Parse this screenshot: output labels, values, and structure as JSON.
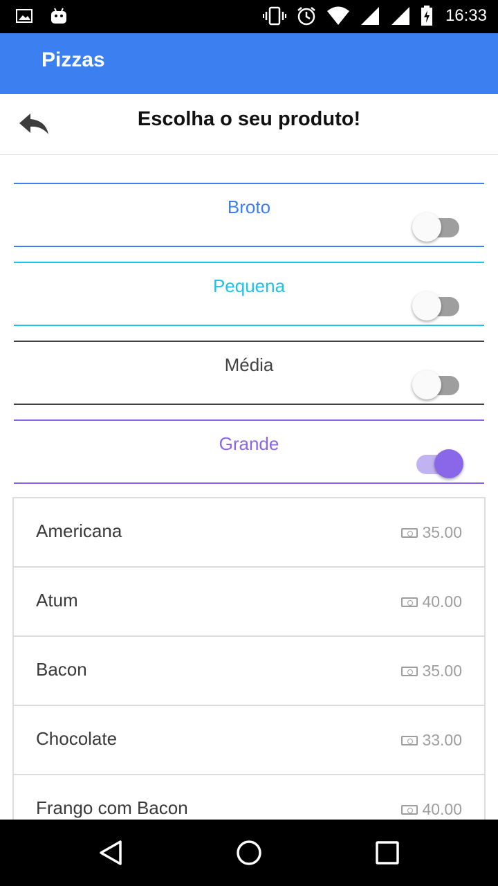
{
  "status_bar": {
    "time": "16:33",
    "icons": [
      "image-icon",
      "android-icon",
      "vibrate-icon",
      "alarm-icon",
      "wifi-icon",
      "signal-icon",
      "signal-icon",
      "battery-charging-icon"
    ]
  },
  "app_bar": {
    "title": "Pizzas",
    "color": "#3b7ff0"
  },
  "header": {
    "title": "Escolha o seu produto!",
    "back_icon": "reply-arrow-icon"
  },
  "sizes": [
    {
      "label": "Broto",
      "color": "#3b7ff0",
      "enabled": false
    },
    {
      "label": "Pequena",
      "color": "#1ec3e9",
      "enabled": false
    },
    {
      "label": "Média",
      "color": "#424242",
      "enabled": false
    },
    {
      "label": "Grande",
      "color": "#8a67e8",
      "enabled": true
    }
  ],
  "products": [
    {
      "name": "Americana",
      "price": "35.00"
    },
    {
      "name": "Atum",
      "price": "40.00"
    },
    {
      "name": "Bacon",
      "price": "35.00"
    },
    {
      "name": "Chocolate",
      "price": "33.00"
    },
    {
      "name": "Frango com Bacon",
      "price": "40.00"
    }
  ],
  "nav_bar": {
    "icons": [
      "back-triangle-icon",
      "home-circle-icon",
      "recents-square-icon"
    ]
  }
}
